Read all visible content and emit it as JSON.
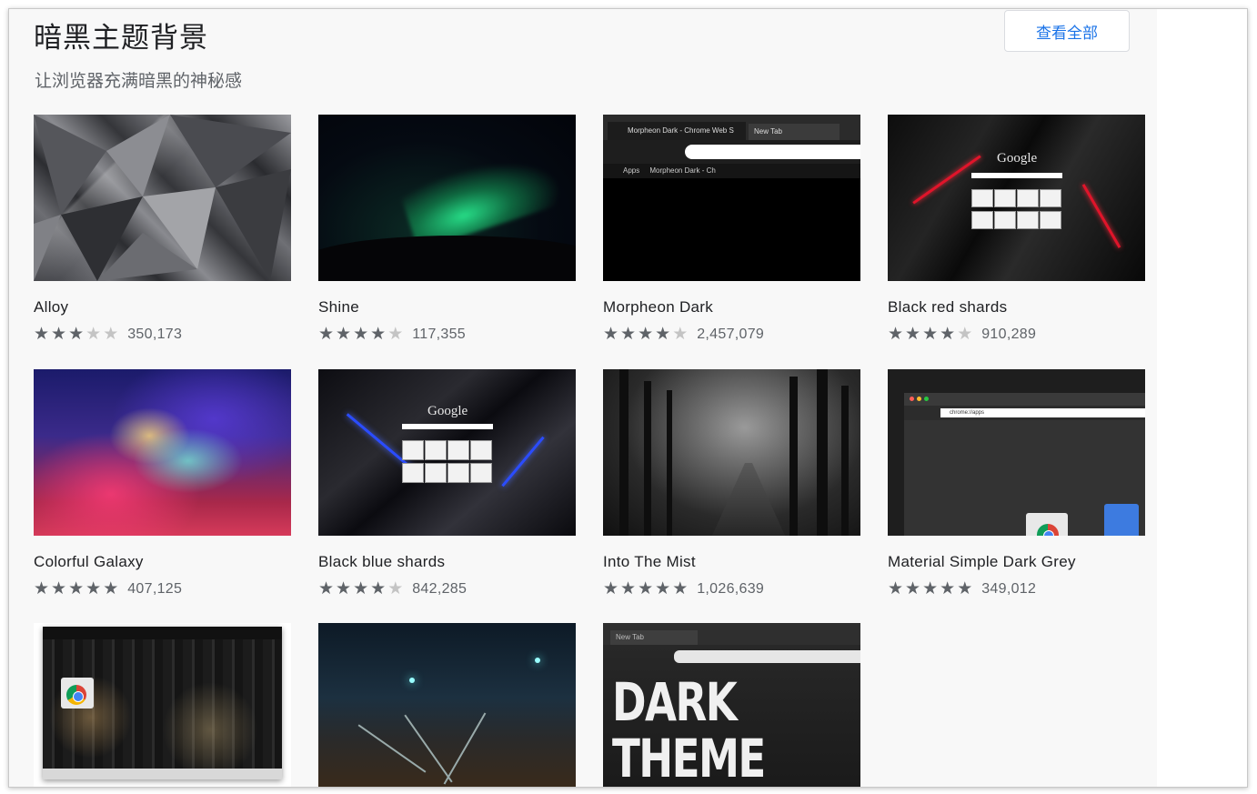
{
  "section": {
    "title": "暗黑主题背景",
    "subtitle": "让浏览器充满暗黑的神秘感",
    "view_all_label": "查看全部"
  },
  "themes": [
    {
      "name": "Alloy",
      "stars": 3,
      "count": "350,173"
    },
    {
      "name": "Shine",
      "stars": 4,
      "count": "117,355"
    },
    {
      "name": "Morpheon Dark",
      "stars": 4,
      "count": "2,457,079"
    },
    {
      "name": "Black red shards",
      "stars": 4,
      "count": "910,289"
    },
    {
      "name": "Colorful Galaxy",
      "stars": 5,
      "count": "407,125"
    },
    {
      "name": "Black blue shards",
      "stars": 4,
      "count": "842,285"
    },
    {
      "name": "Into The Mist",
      "stars": 5,
      "count": "1,026,639"
    },
    {
      "name": "Material Simple Dark Grey",
      "stars": 5,
      "count": "349,012"
    },
    {
      "name": "",
      "stars": 0,
      "count": ""
    },
    {
      "name": "",
      "stars": 0,
      "count": ""
    },
    {
      "name": "",
      "stars": 0,
      "count": ""
    }
  ],
  "thumb_text": {
    "morpheon_tab": "Morpheon Dark - Chrome Web S",
    "new_tab": "New Tab",
    "apps": "Apps",
    "bookmark": "Morpheon Dark - Ch",
    "google": "Google",
    "chrome_apps_url": "chrome://apps",
    "dark_theme_line1": "DARK",
    "dark_theme_line2": "THEME"
  },
  "colors": {
    "accent": "#1a73e8",
    "star_filled": "#5f6368",
    "star_empty": "#c4c4c4"
  }
}
